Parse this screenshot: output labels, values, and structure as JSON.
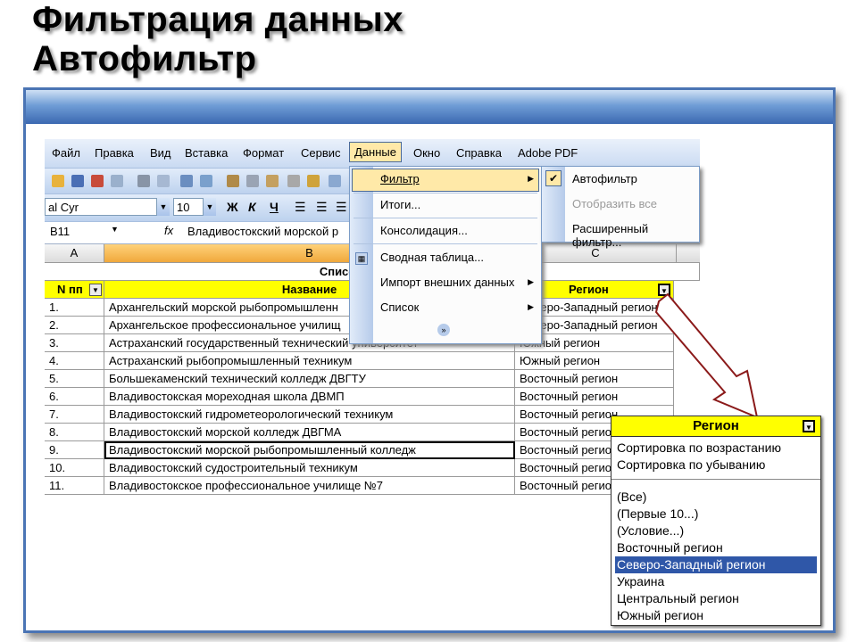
{
  "slide": {
    "title_line1": "Фильтрация данных",
    "title_line2": "Автофильтр"
  },
  "menubar": [
    "Файл",
    "Правка",
    "Вид",
    "Вставка",
    "Формат",
    "Сервис",
    "Данные",
    "Окно",
    "Справка",
    "Adobe PDF"
  ],
  "format_bar": {
    "font": "al Cyr",
    "size": "10",
    "bold": "Ж",
    "italic": "К",
    "underline": "Ч"
  },
  "formula_bar": {
    "cell_ref": "B11",
    "fx": "fx",
    "content": "Владивостокский морской р"
  },
  "columns": [
    "A",
    "B",
    "C"
  ],
  "table": {
    "title": "Список образоват",
    "headers": [
      "N пп",
      "Название",
      "Регион"
    ],
    "rows": [
      {
        "n": "1.",
        "name": "Архангельский морской рыбопромышленн",
        "region": "Северо-Западный регион"
      },
      {
        "n": "2.",
        "name": "Архангельское профессиональное училищ",
        "region": "Северо-Западный регион"
      },
      {
        "n": "3.",
        "name": "Астраханский государственный технический университет",
        "region": "Южный регион"
      },
      {
        "n": "4.",
        "name": "Астраханский рыбопромышленный техникум",
        "region": "Южный регион"
      },
      {
        "n": "5.",
        "name": "Большекаменский технический колледж ДВГТУ",
        "region": "Восточный регион"
      },
      {
        "n": "6.",
        "name": "Владивостокская мореходная школа ДВМП",
        "region": "Восточный регион"
      },
      {
        "n": "7.",
        "name": "Владивостокский гидрометеорологический техникум",
        "region": "Восточный регион"
      },
      {
        "n": "8.",
        "name": "Владивостокский морской колледж ДВГМА",
        "region": "Восточный регион"
      },
      {
        "n": "9.",
        "name": "Владивостокский морской рыбопромышленный колледж",
        "region": "Восточный регион"
      },
      {
        "n": "10.",
        "name": "Владивостокский судостроительный техникум",
        "region": "Восточный регион"
      },
      {
        "n": "11.",
        "name": "Владивостокское профессиональное училище №7",
        "region": "Восточный регион"
      }
    ]
  },
  "data_menu": [
    "Фильтр",
    "Итоги...",
    "Консолидация...",
    "Сводная таблица...",
    "Импорт внешних данных",
    "Список"
  ],
  "filter_submenu": [
    "Автофильтр",
    "Отобразить все",
    "Расширенный фильтр..."
  ],
  "region_dropdown": {
    "header": "Регион",
    "sort_items": [
      "Сортировка по возрастанию",
      "Сортировка по убыванию"
    ],
    "filter_items": [
      "(Все)",
      "(Первые 10...)",
      "(Условие...)",
      "Восточный регион",
      "Северо-Западный регион",
      "Украина",
      "Центральный регион",
      "Южный регион"
    ]
  },
  "colors": {
    "accent": "#3b68b1",
    "header_yellow": "#ffff00",
    "highlight": "#ffe9a8",
    "selection": "#2f57a8",
    "arrow": "#8b1a1a"
  }
}
